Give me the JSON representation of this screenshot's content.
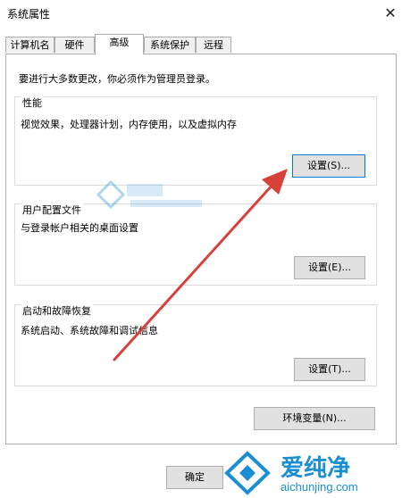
{
  "window": {
    "title": "系统属性"
  },
  "tabs": [
    {
      "label": "计算机名"
    },
    {
      "label": "硬件"
    },
    {
      "label": "高级"
    },
    {
      "label": "系统保护"
    },
    {
      "label": "远程"
    }
  ],
  "admin_note": "要进行大多数更改，你必须作为管理员登录。",
  "groups": {
    "performance": {
      "title": "性能",
      "desc": "视觉效果，处理器计划，内存使用，以及虚拟内存",
      "button": "设置(S)..."
    },
    "user_profiles": {
      "title": "用户配置文件",
      "desc": "与登录帐户相关的桌面设置",
      "button": "设置(E)..."
    },
    "startup_recovery": {
      "title": "启动和故障恢复",
      "desc": "系统启动、系统故障和调试信息",
      "button": "设置(T)..."
    }
  },
  "env_button": "环境变量(N)...",
  "ok_button": "确定",
  "watermark": {
    "brand": "爱纯净",
    "domain": "aichunjing.com"
  },
  "colors": {
    "arrow": "#d8413a",
    "watermark": "#1a8ed2",
    "focus_border": "#0078d7"
  }
}
